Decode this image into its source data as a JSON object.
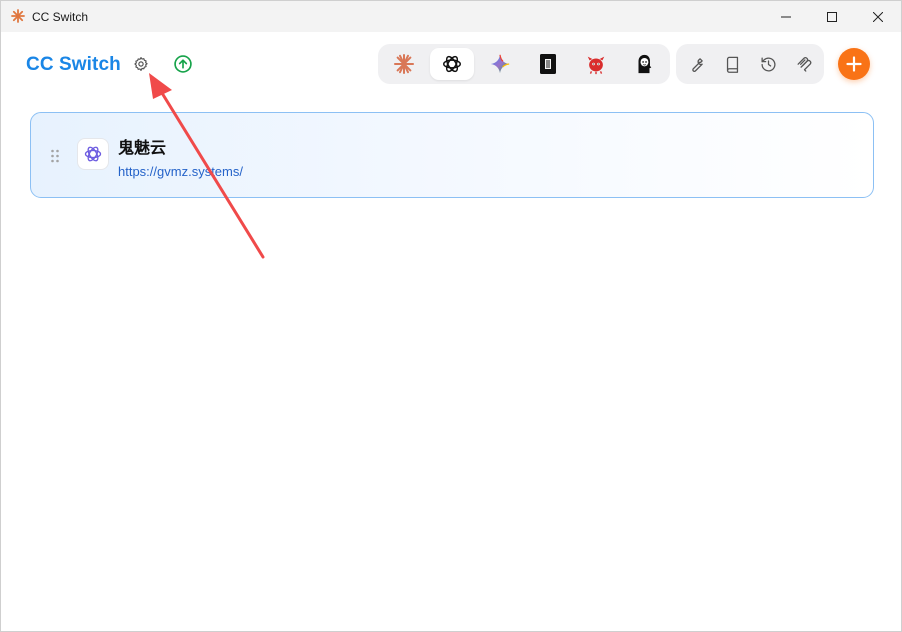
{
  "window": {
    "title": "CC Switch",
    "controls": [
      "minimize-icon",
      "maximize-icon",
      "close-icon"
    ]
  },
  "header": {
    "brand": "CC Switch",
    "brand_color": "#1a86e6",
    "settings_icon": "gear-icon",
    "update_icon": "arrow-up-circle-icon",
    "update_color": "#16a34a"
  },
  "app_switcher": {
    "active": "openai-codex",
    "items": [
      {
        "id": "claude",
        "icon": "claude-asterisk-icon"
      },
      {
        "id": "openai-codex",
        "icon": "openai-logo-icon"
      },
      {
        "id": "gemini",
        "icon": "gemini-sparkle-icon"
      },
      {
        "id": "app-4",
        "icon": "dark-square-app-icon"
      },
      {
        "id": "app-5",
        "icon": "red-creature-icon"
      },
      {
        "id": "app-6",
        "icon": "black-character-icon"
      }
    ]
  },
  "tools": [
    {
      "id": "tools",
      "icon": "wrench-icon"
    },
    {
      "id": "docs",
      "icon": "book-icon"
    },
    {
      "id": "history",
      "icon": "history-icon"
    },
    {
      "id": "mcp",
      "icon": "mcp-icon"
    }
  ],
  "add_button": {
    "icon": "plus-icon",
    "color": "#f97316"
  },
  "providers": [
    {
      "name": "鬼魅云",
      "url": "https://gvmz.systems/",
      "icon": "openai-logo-icon",
      "selected": true
    }
  ],
  "annotation": {
    "type": "arrow",
    "color": "#f04a4a",
    "points_to": "settings-button"
  }
}
